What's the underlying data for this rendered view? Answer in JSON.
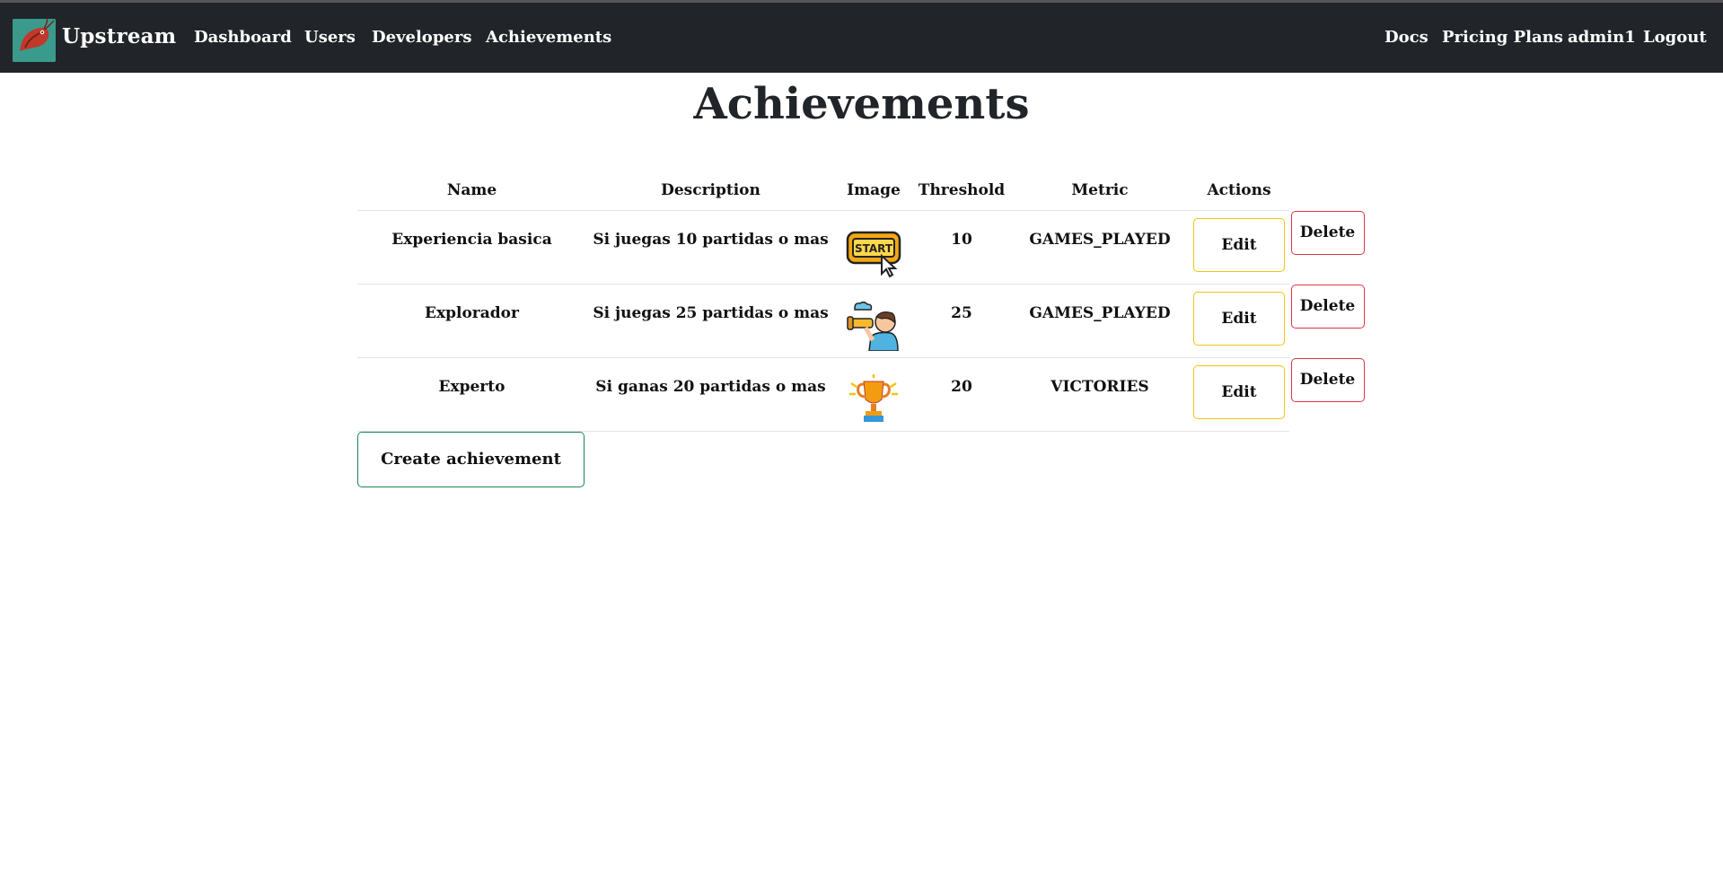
{
  "navbar": {
    "brand": "Upstream",
    "links": [
      "Dashboard",
      "Users",
      "Developers",
      "Achievements"
    ],
    "right_links": [
      "Docs",
      "Pricing Plans",
      "admin1",
      "Logout"
    ],
    "background": "#212529"
  },
  "page": {
    "title": "Achievements"
  },
  "table": {
    "headers": [
      "Name",
      "Description",
      "Image",
      "Threshold",
      "Metric",
      "Actions"
    ],
    "rows": [
      {
        "name": "Experiencia basica",
        "description": "Si juegas 10 partidas o mas",
        "image_icon": "start-button-icon",
        "threshold": "10",
        "metric": "GAMES_PLAYED"
      },
      {
        "name": "Explorador",
        "description": "Si juegas 25 partidas o mas",
        "image_icon": "explorer-binoculars-icon",
        "threshold": "25",
        "metric": "GAMES_PLAYED"
      },
      {
        "name": "Experto",
        "description": "Si ganas 20 partidas o mas",
        "image_icon": "trophy-icon",
        "threshold": "20",
        "metric": "VICTORIES"
      }
    ],
    "edit_label": "Edit",
    "delete_label": "Delete"
  },
  "create_button_label": "Create achievement",
  "colors": {
    "edit_border": "#f1c40f",
    "delete_border": "#dc3545",
    "create_border": "#198754"
  }
}
